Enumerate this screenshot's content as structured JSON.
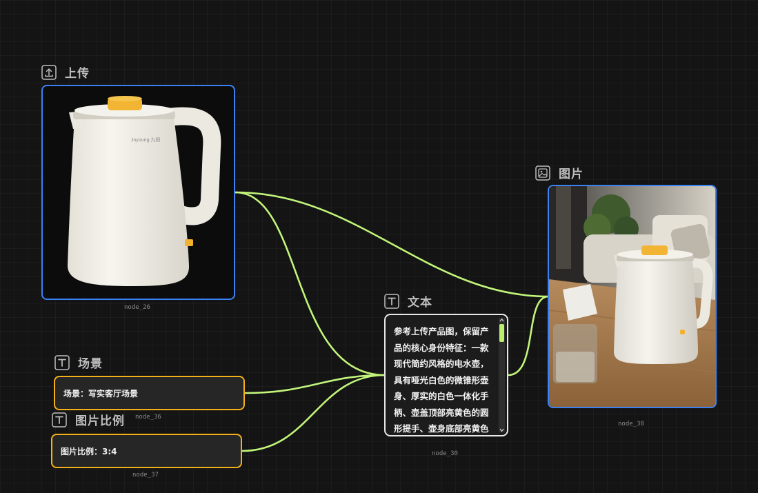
{
  "nodes": {
    "upload": {
      "title": "上传",
      "icon": "upload-icon",
      "id": "node_26"
    },
    "image": {
      "title": "图片",
      "icon": "image-icon",
      "id": "node_38"
    },
    "text": {
      "title": "文本",
      "icon": "text-icon",
      "id": "node_30",
      "content": "参考上传产品图，保留产品的核心身份特征：一款现代简约风格的电水壶，具有哑光白色的微锥形壶身、厚实的白色一体化手柄、壶盖顶部亮黄色的圆形提手、壶身底部亮黄色的开关"
    },
    "scene": {
      "title": "场景",
      "icon": "text-icon",
      "id": "node_36",
      "content": "场景：写实客厅场景"
    },
    "ratio": {
      "title": "图片比例",
      "icon": "text-icon",
      "id": "node_37",
      "content": "图片比例：3:4"
    }
  },
  "kettle_brand": "Joyoung 九阳",
  "colors": {
    "wire": "#c2f57a",
    "image_border": "#3b82f6",
    "text_card_border": "#f5b11a",
    "text_node_border": "#e8e8e8",
    "canvas": "#141414"
  }
}
